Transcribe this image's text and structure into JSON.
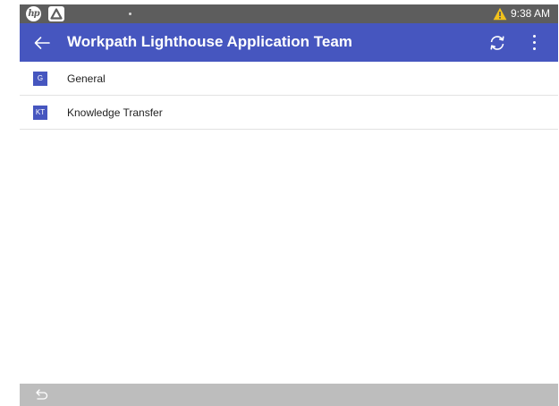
{
  "status_bar": {
    "time": "9:38 AM",
    "hp_logo_text": "hp",
    "icons": [
      "hp-logo",
      "app-badge-icon",
      "warning-icon"
    ],
    "warning_color": "#f2c21b"
  },
  "app_bar": {
    "title": "Workpath Lighthouse Application Team",
    "icons": [
      "back-arrow-icon",
      "refresh-icon",
      "more-vert-icon"
    ],
    "color": "#4656bf"
  },
  "channels": [
    {
      "avatar": "G",
      "name": "General"
    },
    {
      "avatar": "KT",
      "name": "Knowledge Transfer"
    }
  ],
  "nav_bar": {
    "icons": [
      "system-back-icon"
    ],
    "color": "#bdbdbd"
  }
}
